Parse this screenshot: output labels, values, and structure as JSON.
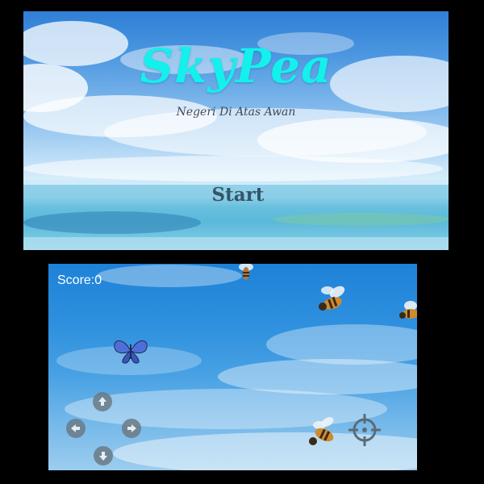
{
  "title_screen": {
    "title": "SkyPea",
    "subtitle": "Negeri Di Atas Awan",
    "start_label": "Start"
  },
  "play_screen": {
    "score_label": "Score:0",
    "controls": {
      "up_icon": "arrow-up-icon",
      "down_icon": "arrow-down-icon",
      "left_icon": "arrow-left-icon",
      "right_icon": "arrow-right-icon",
      "fire_icon": "crosshair-icon"
    },
    "sprites": [
      "bee",
      "bee",
      "bee",
      "bee",
      "butterfly"
    ]
  },
  "colors": {
    "title": "#14f0ec",
    "subtitle": "#3d4a5a",
    "start": "#35546a",
    "score": "#ffffff",
    "control": "#6b7a85"
  }
}
